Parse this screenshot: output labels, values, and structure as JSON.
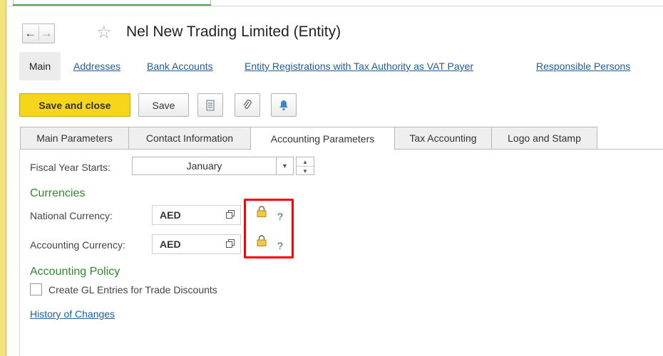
{
  "window": {
    "title": "Nel New Trading Limited (Entity)"
  },
  "sections": {
    "main": "Main",
    "links": [
      "Addresses",
      "Bank Accounts",
      "Entity Registrations with Tax Authority as VAT Payer",
      "Responsible Persons"
    ]
  },
  "toolbar": {
    "save_close_label": "Save and close",
    "save_label": "Save"
  },
  "tabs": [
    {
      "label": "Main Parameters",
      "active": false
    },
    {
      "label": "Contact Information",
      "active": false
    },
    {
      "label": "Accounting Parameters",
      "active": true
    },
    {
      "label": "Tax Accounting",
      "active": false
    },
    {
      "label": "Logo and Stamp",
      "active": false
    }
  ],
  "form": {
    "fiscal_label": "Fiscal Year Starts:",
    "fiscal_value": "January",
    "currencies_heading": "Currencies",
    "national_label": "National Currency:",
    "national_value": "AED",
    "accounting_label": "Accounting Currency:",
    "accounting_value": "AED",
    "help_symbol": "?",
    "policy_heading": "Accounting Policy",
    "gl_checkbox_label": "Create GL Entries for Trade Discounts",
    "gl_checked": false,
    "history_link": "History of Changes"
  },
  "colors": {
    "accent_yellow": "#f6d61b",
    "link_blue": "#1f5e96",
    "heading_green": "#2d8a2d",
    "highlight_red": "#ff0000"
  },
  "icons": [
    "back-arrow-icon",
    "forward-arrow-icon",
    "favorite-star-icon",
    "document-icon",
    "paperclip-icon",
    "bell-icon",
    "open-icon",
    "lock-icon"
  ]
}
